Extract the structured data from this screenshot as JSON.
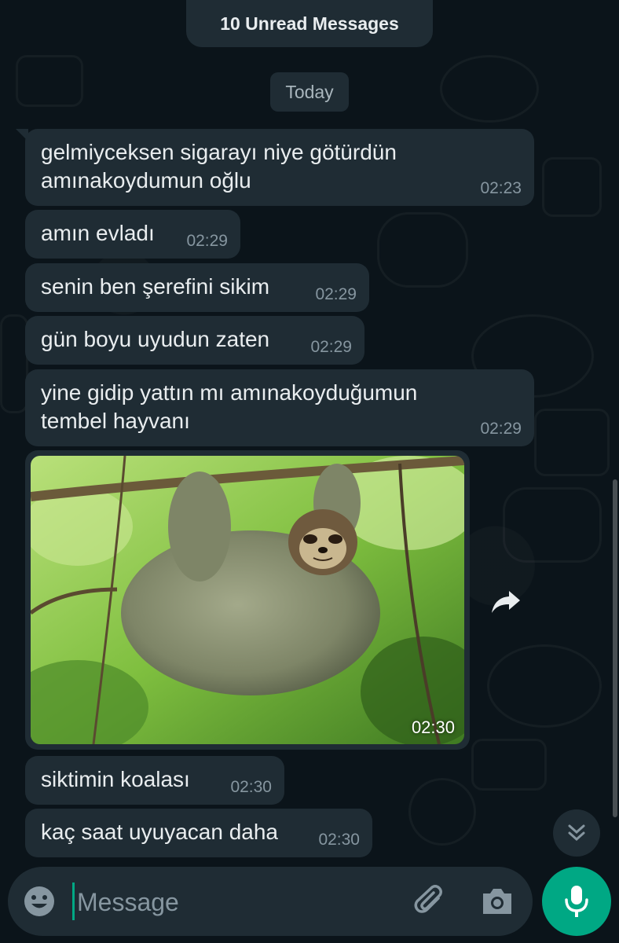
{
  "banner": {
    "unread": "10 Unread Messages",
    "date": "Today"
  },
  "messages": [
    {
      "text": "gelmiyceksen sigarayı niye götürdün\namınakoydumun oğlu",
      "time": "02:23"
    },
    {
      "text": "amın evladı",
      "time": "02:29"
    },
    {
      "text": "senin ben şerefini sikim",
      "time": "02:29"
    },
    {
      "text": "gün boyu uyudun zaten",
      "time": "02:29"
    },
    {
      "text": "yine gidip yattın mı amınakoyduğumun\ntembel hayvanı",
      "time": "02:29"
    },
    {
      "text": "siktimin koalası",
      "time": "02:30"
    },
    {
      "text": "kaç saat uyuyacan daha",
      "time": "02:30"
    }
  ],
  "image_message": {
    "time": "02:30",
    "subject": "sloth-hanging-from-branch"
  },
  "composer": {
    "placeholder": "Message"
  },
  "icons": {
    "forward": "forward-icon",
    "scroll_down": "double-chevron-down-icon",
    "emoji": "emoji-icon",
    "attach": "paperclip-icon",
    "camera": "camera-icon",
    "mic": "microphone-icon"
  },
  "colors": {
    "background": "#0b141a",
    "bubble": "#1f2c34",
    "accent": "#00a884",
    "meta_text": "#8696a0"
  }
}
